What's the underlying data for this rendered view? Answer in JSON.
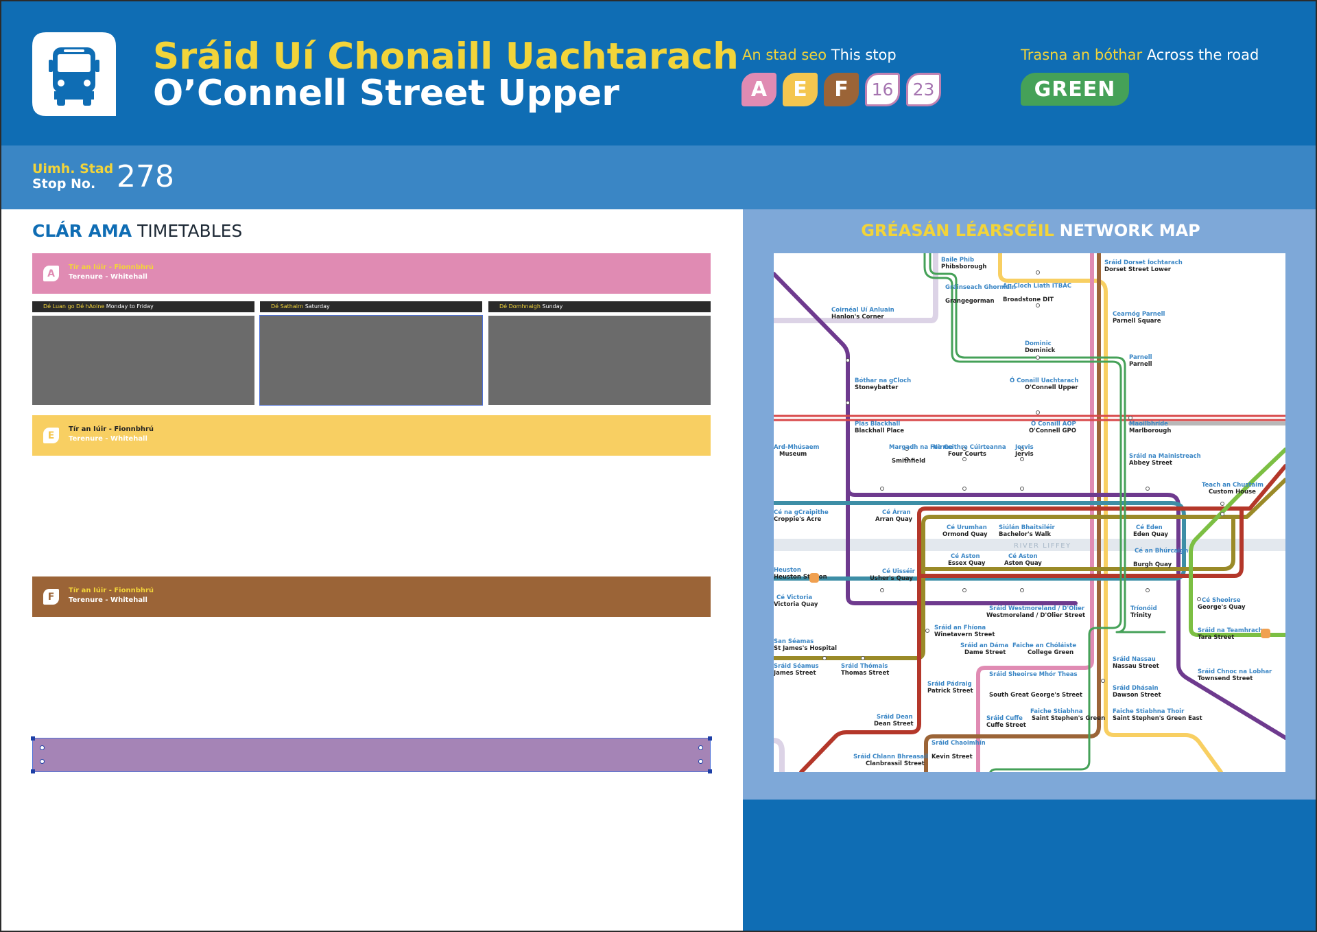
{
  "header": {
    "title_ga": "Sráid Uí Chonaill Uachtarach",
    "title_en": "O’Connell Street Upper",
    "this_stop_ga": "An stad seo",
    "this_stop_en": "This stop",
    "routes": [
      {
        "label": "A",
        "color": "#e08bb3",
        "style": "filled"
      },
      {
        "label": "E",
        "color": "#f4c64f",
        "style": "filled"
      },
      {
        "label": "F",
        "color": "#9b6437",
        "style": "filled"
      },
      {
        "label": "16",
        "color": "#c081b1",
        "style": "outline"
      },
      {
        "label": "23",
        "color": "#c081b1",
        "style": "outline"
      }
    ],
    "across_ga": "Trasna an bóthar",
    "across_en": "Across the road",
    "across_route": "GREEN",
    "across_color": "#45a158"
  },
  "stop": {
    "label_ga": "Uimh. Stad",
    "label_en": "Stop No.",
    "number": "278"
  },
  "timetables": {
    "title_ga": "CLÁR AMA",
    "title_en": "TIMETABLES",
    "routes": [
      {
        "badge": "A",
        "color": "#e08bb3",
        "dest_ga": "Tír an Iúir - Fionnbhrú",
        "dest_en": "Terenure - Whitehall"
      },
      {
        "badge": "E",
        "color": "#f8cf62",
        "dest_ga": "Tír an Iúir - Fionnbhrú",
        "dest_en": "Terenure - Whitehall"
      },
      {
        "badge": "F",
        "color": "#9b6437",
        "dest_ga": "Tír an Iúir - Fionnbhrú",
        "dest_en": "Terenure - Whitehall"
      }
    ],
    "days": [
      {
        "ga": "Dé Luan go Dé hAoine",
        "en": "Monday to Friday"
      },
      {
        "ga": "Dé Sathairn",
        "en": "Saturday"
      },
      {
        "ga": "Dé Domhnaigh",
        "en": "Sunday"
      }
    ]
  },
  "network_map": {
    "title_ga": "GRÉASÁN LÉARSCÉIL",
    "title_en": "NETWORK MAP",
    "river": "RIVER LIFFEY",
    "stations": [
      {
        "ga": "Baile Phib",
        "en": "Phibsborough"
      },
      {
        "ga": "Gráinseach Ghormáin",
        "en": "Grangegorman"
      },
      {
        "ga": "An Cloch Liath ITBÁC",
        "en": "Broadstone DIT"
      },
      {
        "ga": "Sráid Dorset Íochtarach",
        "en": "Dorset Street Lower"
      },
      {
        "ga": "Coirnéal Uí Anluain",
        "en": "Hanlon's Corner"
      },
      {
        "ga": "Cearnóg Parnell",
        "en": "Parnell Square"
      },
      {
        "ga": "Dominic",
        "en": "Dominick"
      },
      {
        "ga": "Parnell",
        "en": "Parnell"
      },
      {
        "ga": "Bóthar na gCloch",
        "en": "Stoneybatter"
      },
      {
        "ga": "Ó Conaill Uachtarach",
        "en": "O'Connell Upper"
      },
      {
        "ga": "Plás Blackhall",
        "en": "Blackhall Place"
      },
      {
        "ga": "Ó Conaill AOP",
        "en": "O'Connell GPO"
      },
      {
        "ga": "Maoilbhríde",
        "en": "Marlborough"
      },
      {
        "ga": "Ard-Mhúsaem",
        "en": "Museum"
      },
      {
        "ga": "Margadh na Feirme",
        "en": "Smithfield"
      },
      {
        "ga": "Na Ceithre Cúirteanna",
        "en": "Four Courts"
      },
      {
        "ga": "Jervis",
        "en": "Jervis"
      },
      {
        "ga": "Sráid na Mainistreach",
        "en": "Abbey Street"
      },
      {
        "ga": "Teach an Chustaim",
        "en": "Custom House"
      },
      {
        "ga": "Cé na gCraipithe",
        "en": "Croppie's Acre"
      },
      {
        "ga": "Cé Árran",
        "en": "Arran Quay"
      },
      {
        "ga": "Cé Urumhan",
        "en": "Ormond Quay"
      },
      {
        "ga": "Siúlán Bhaitsiléir",
        "en": "Bachelor's Walk"
      },
      {
        "ga": "Cé Eden",
        "en": "Eden Quay"
      },
      {
        "ga": "Cé Aston",
        "en": "Essex Quay"
      },
      {
        "ga": "Cé Aston",
        "en": "Aston Quay"
      },
      {
        "ga": "Cé an Bhúrcaigh",
        "en": "Burgh Quay"
      },
      {
        "ga": "Heuston",
        "en": "Heuston Station"
      },
      {
        "ga": "Cé Uisséir",
        "en": "Usher's Quay"
      },
      {
        "ga": "Cé Victoria",
        "en": "Victoria Quay"
      },
      {
        "ga": "Sráid Westmoreland / D'Olier",
        "en": "Westmoreland / D'Olier Street"
      },
      {
        "ga": "Tríonóid",
        "en": "Trinity"
      },
      {
        "ga": "Cé Sheoirse",
        "en": "George's Quay"
      },
      {
        "ga": "Sráid an Fhíona",
        "en": "Winetavern Street"
      },
      {
        "ga": "San Séamas",
        "en": "St James's Hospital"
      },
      {
        "ga": "Sráid an Dáma",
        "en": "Dame Street"
      },
      {
        "ga": "Faiche an Chóláiste",
        "en": "College Green"
      },
      {
        "ga": "Sráid na Teamhrach",
        "en": "Tara Street"
      },
      {
        "ga": "Sráid Séamus",
        "en": "James Street"
      },
      {
        "ga": "Sráid Thómais",
        "en": "Thomas Street"
      },
      {
        "ga": "Sráid Nassau",
        "en": "Nassau Street"
      },
      {
        "ga": "Sráid Chnoc na Lobhar",
        "en": "Townsend Street"
      },
      {
        "ga": "Sráid Sheoirse Mhór Theas",
        "en": "South Great George's Street"
      },
      {
        "ga": "Sráid Pádraig",
        "en": "Patrick Street"
      },
      {
        "ga": "Sráid Dhásain",
        "en": "Dawson Street"
      },
      {
        "ga": "Sráid Dean",
        "en": "Dean Street"
      },
      {
        "ga": "Sráid Cuffe",
        "en": "Cuffe Street"
      },
      {
        "ga": "Faiche Stiabhna",
        "en": "Saint Stephen's Green"
      },
      {
        "ga": "Faiche Stiabhna Thoir",
        "en": "Saint Stephen's Green East"
      },
      {
        "ga": "Sráid Chaoimhín",
        "en": "Kevin Street"
      },
      {
        "ga": "Sráid Chlann Bhreasail",
        "en": "Clanbrassil Street"
      }
    ]
  }
}
